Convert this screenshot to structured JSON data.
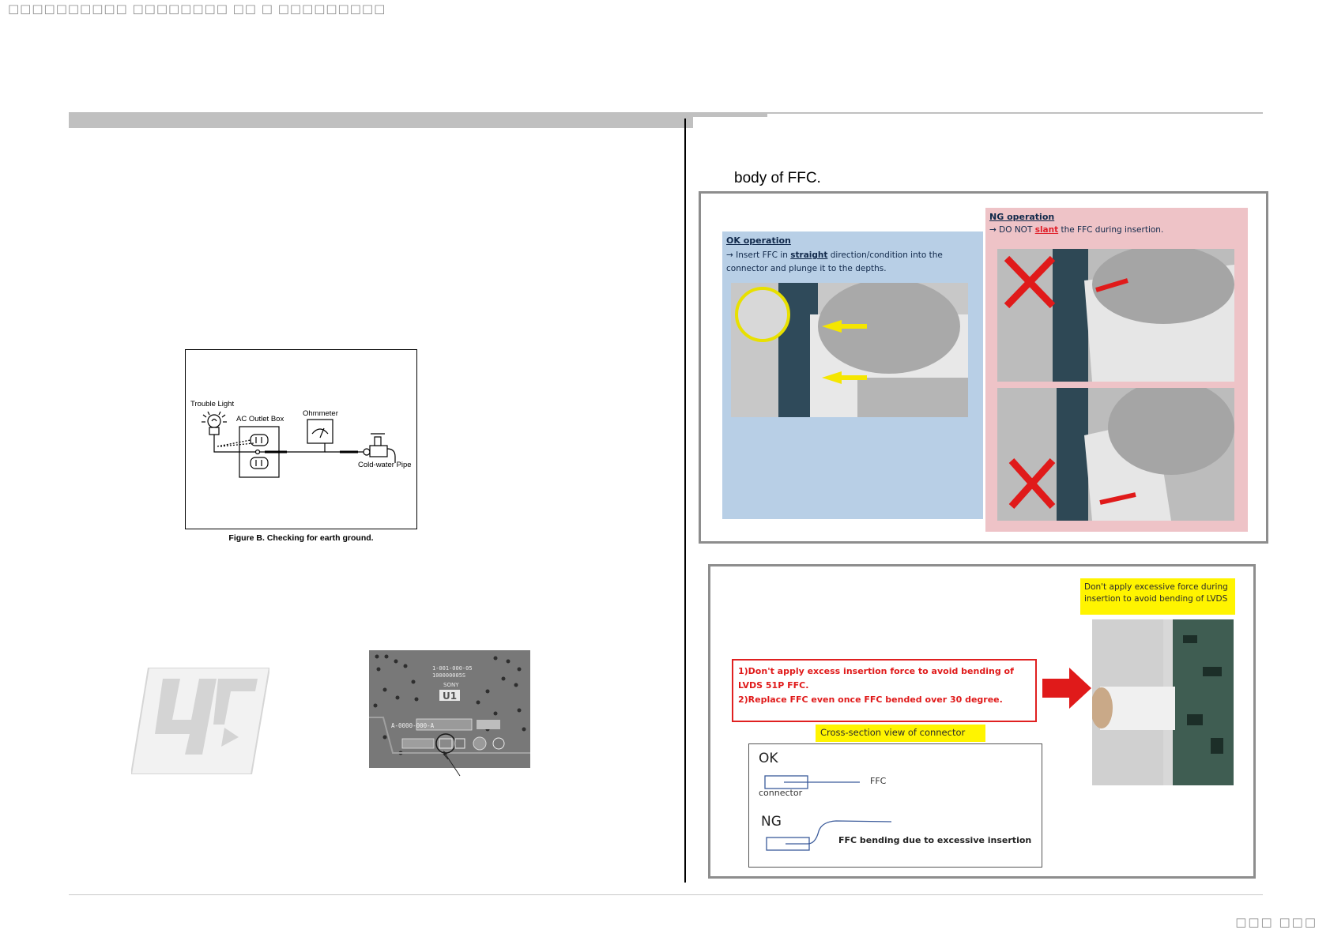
{
  "header": {
    "garbled_text": "□□□□□□□□□□ □□□□□□□□ □□ □ □□□□□□□□□",
    "page_number": "□□□ □□□"
  },
  "right_column": {
    "intro_fragment": "body of FFC."
  },
  "figure_b": {
    "caption": "Figure B. Checking for earth ground.",
    "labels": {
      "trouble_light": "Trouble Light",
      "ac_outlet_box": "AC Outlet Box",
      "ohmmeter": "Ohmmeter",
      "cold_water_pipe": "Cold-water Pipe"
    }
  },
  "board_photo": {
    "line1": "1-001-000-05",
    "line2": "100000005S",
    "brand": "SONY",
    "ref": "U1",
    "part": "A-0000-000-A"
  },
  "ffc_insertion": {
    "ok": {
      "title": "OK operation",
      "text_before": "→ Insert FFC in ",
      "emph": "straight",
      "text_after": " direction/condition into the connector and plunge it to the depths."
    },
    "ng": {
      "title": "NG operation",
      "text_before": "→ DO NOT ",
      "emph": "slant",
      "text_after": " the FFC during insertion."
    }
  },
  "ffc_bending": {
    "warning_line1": "1)Don't apply excess insertion force to avoid bending of LVDS 51P FFC.",
    "warning_line2": "2)Replace FFC even once FFC bended over 30 degree.",
    "photo_note": "Don't apply excessive force during insertion to avoid bending of LVDS",
    "cross_section_title": "Cross-section view of connector",
    "ok_label": "OK",
    "ffc_label": "FFC",
    "connector_label": "connector",
    "ng_label": "NG",
    "ng_caption": "FFC bending due to excessive insertion"
  }
}
